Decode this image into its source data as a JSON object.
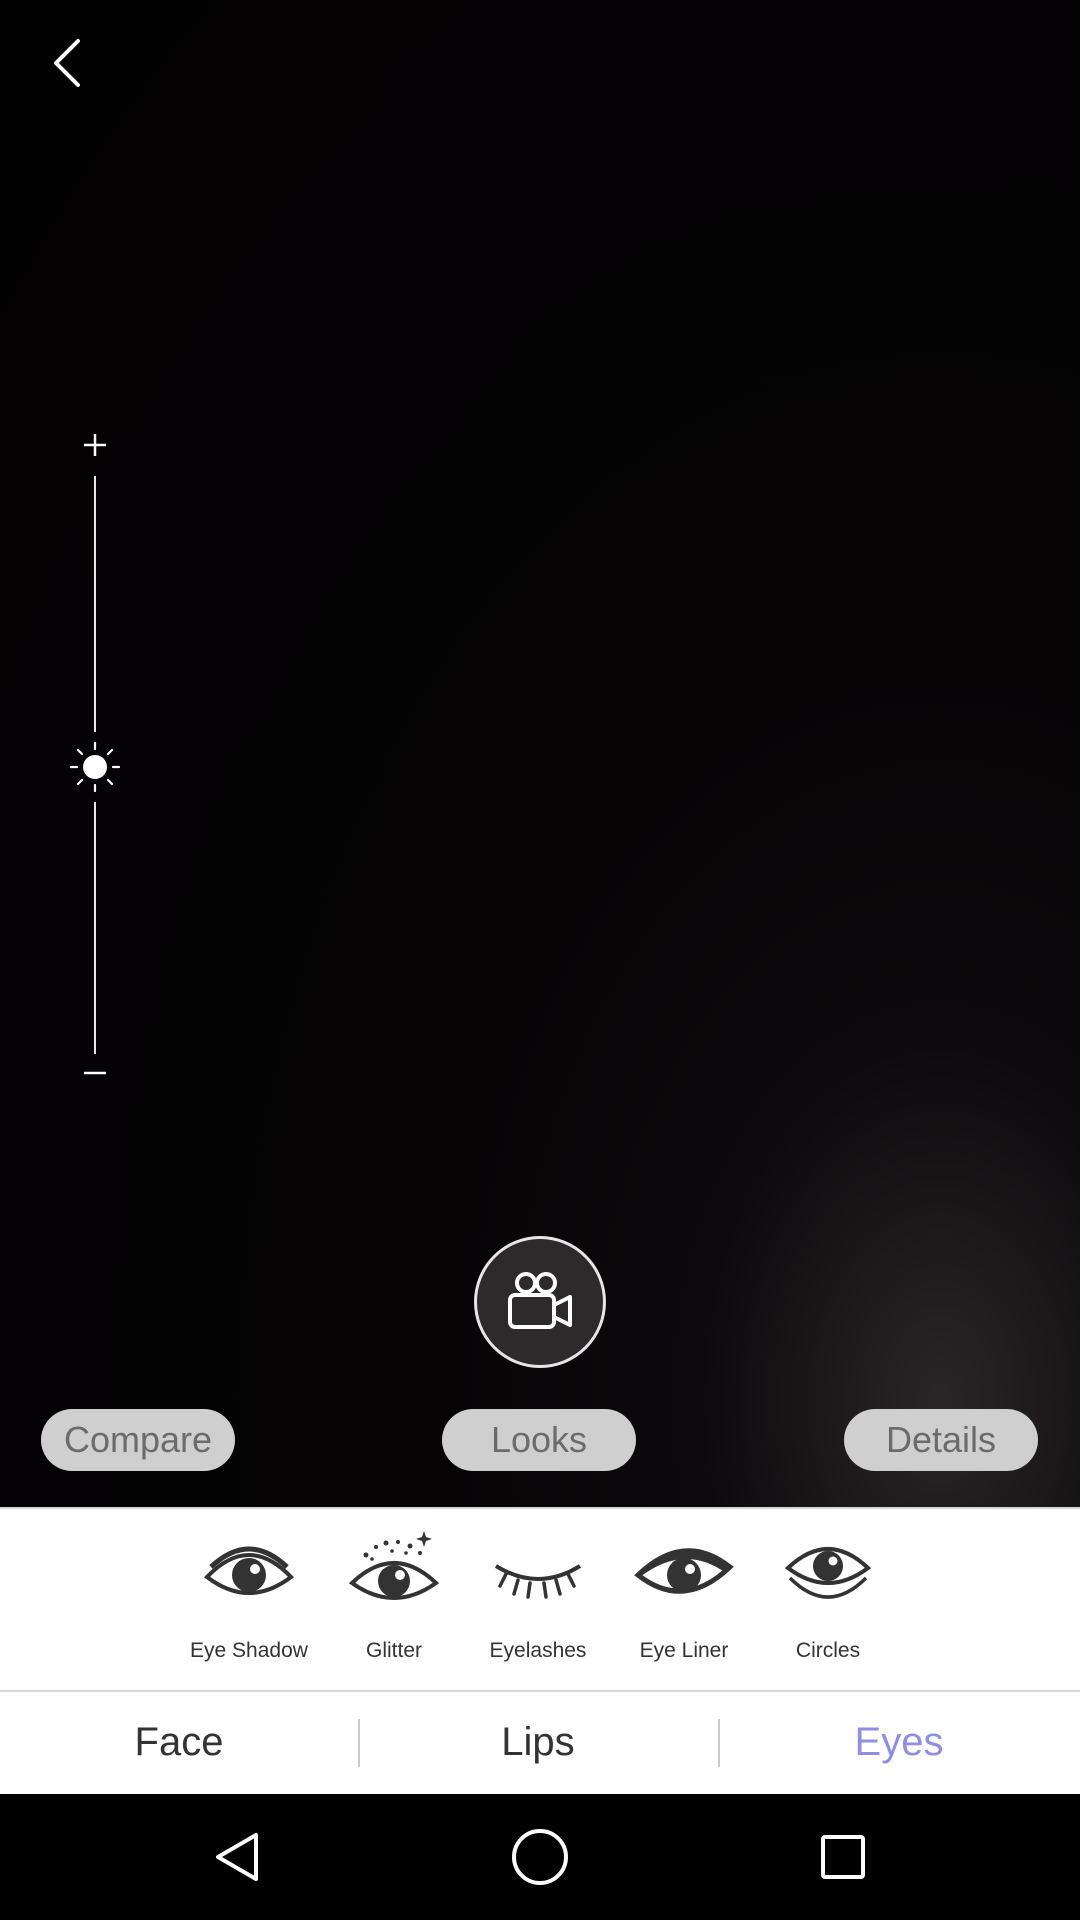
{
  "camera": {
    "compare_label": "Compare",
    "looks_label": "Looks",
    "details_label": "Details"
  },
  "brightness_slider": {
    "plus_symbol": "+",
    "minus_symbol": "–",
    "level": 0.5
  },
  "features": [
    {
      "label": "Eye Shadow",
      "icon": "eye-shadow-icon"
    },
    {
      "label": "Glitter",
      "icon": "glitter-eye-icon"
    },
    {
      "label": "Eyelashes",
      "icon": "eyelashes-icon"
    },
    {
      "label": "Eye Liner",
      "icon": "eye-liner-icon"
    },
    {
      "label": "Circles",
      "icon": "circles-eye-icon"
    }
  ],
  "tabs": [
    {
      "label": "Face",
      "active": false
    },
    {
      "label": "Lips",
      "active": false
    },
    {
      "label": "Eyes",
      "active": true
    }
  ],
  "colors": {
    "active_tab": "#8f8ee6",
    "pill_background": "#cfcfcf",
    "pill_text": "#6b6b6b"
  },
  "system_nav": {
    "back": "triangle-back-icon",
    "home": "circle-home-icon",
    "recents": "square-recents-icon"
  }
}
